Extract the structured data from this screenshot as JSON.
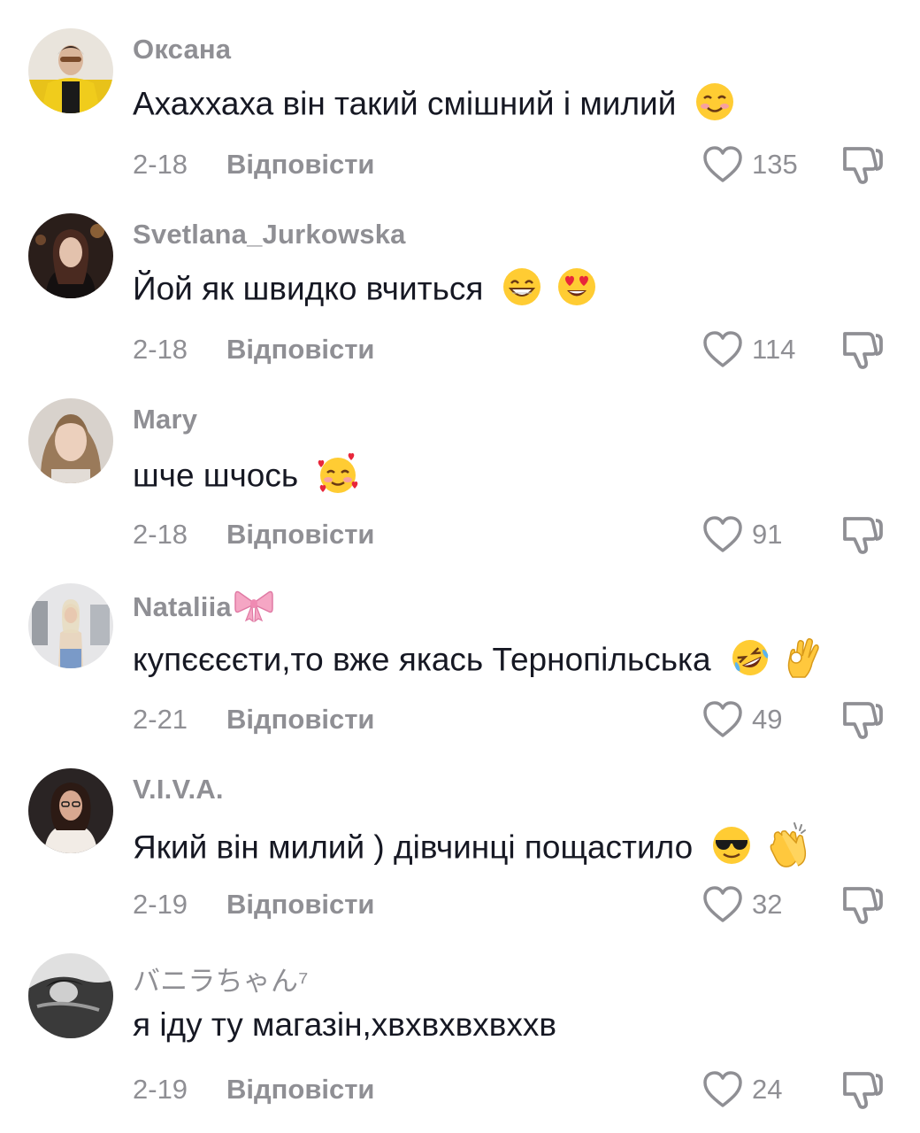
{
  "comments": [
    {
      "username": "Оксана",
      "text": "Ахаххаха він такий смішний і милий",
      "emojis": [
        "smiling-face-emoji"
      ],
      "date": "2-18",
      "reply_label": "Відповісти",
      "likes": "135"
    },
    {
      "username": "Svetlana_Jurkowska",
      "text": "Йой як швидко вчиться",
      "emojis": [
        "grinning-face-emoji",
        "heart-eyes-emoji"
      ],
      "date": "2-18",
      "reply_label": "Відповісти",
      "likes": "114"
    },
    {
      "username": "Mary",
      "text": "шче шчось",
      "emojis": [
        "smiling-face-with-hearts-emoji"
      ],
      "date": "2-18",
      "reply_label": "Відповісти",
      "likes": "91"
    },
    {
      "username": "Nataliia",
      "username_suffix_icon": "ribbon-bow-emoji",
      "text": "купєєєєти,то вже якась Тернопільська",
      "emojis": [
        "rolling-laughing-emoji",
        "ok-hand-emoji"
      ],
      "date": "2-21",
      "reply_label": "Відповісти",
      "likes": "49"
    },
    {
      "username": "V.I.V.A.",
      "text": "Який він милий ) дівчинці пощастило",
      "emojis": [
        "sunglasses-face-emoji",
        "clapping-hands-emoji"
      ],
      "date": "2-19",
      "reply_label": "Відповісти",
      "likes": "32"
    },
    {
      "username": "バニラちゃん⁷",
      "text": "я іду ту магазін,хвхвхвхвххв",
      "emojis": [],
      "date": "2-19",
      "reply_label": "Відповісти",
      "likes": "24"
    }
  ],
  "icons": {
    "like": "heart-outline-icon",
    "dislike": "thumbs-down-outline-icon"
  },
  "colors": {
    "text": "#161823",
    "secondary": "#8f8f94",
    "background": "#ffffff"
  }
}
